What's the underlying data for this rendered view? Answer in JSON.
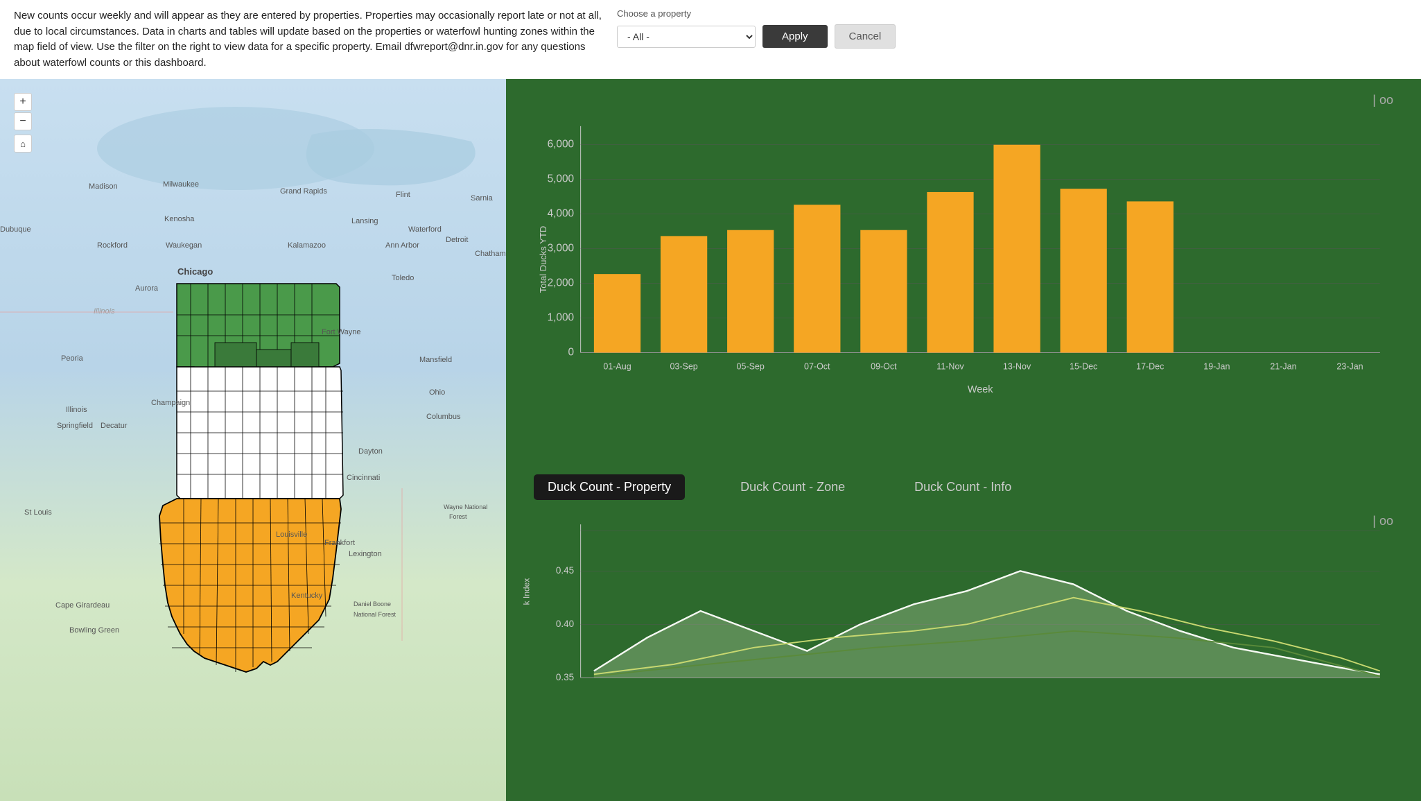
{
  "topbar": {
    "description": "New counts occur weekly and will appear as they are entered by properties. Properties may occasionally report late or not at all, due to local circumstances. Data in charts and tables will update based on the properties or waterfowl hunting zones within the map field of view.  Use the filter on the right to view data for a specific property.  Email dfwreport@dnr.in.gov for any questions about waterfowl counts or this dashboard.",
    "email_link": "dfwreport@dnr.in.gov",
    "choose_label": "Choose a property",
    "select_default": "- All -",
    "apply_label": "Apply",
    "cancel_label": "Cancel"
  },
  "map": {
    "zoom_in_label": "+",
    "zoom_out_label": "−",
    "home_icon": "⌂"
  },
  "chart": {
    "y_label": "Total Ducks YTD",
    "x_label": "Week",
    "icons": "oo",
    "bars": [
      {
        "week": "01-Aug",
        "value": 2500
      },
      {
        "week": "03-Sep",
        "value": 3700
      },
      {
        "week": "05-Sep",
        "value": 3900
      },
      {
        "week": "07-Oct",
        "value": 4700
      },
      {
        "week": "09-Oct",
        "value": 3900
      },
      {
        "week": "11-Nov",
        "value": 5100
      },
      {
        "week": "13-Nov",
        "value": 6600
      },
      {
        "week": "15-Dec",
        "value": 5200
      },
      {
        "week": "17-Dec",
        "value": 4800
      },
      {
        "week": "19-Jan",
        "value": 0
      },
      {
        "week": "21-Jan",
        "value": 0
      },
      {
        "week": "23-Jan",
        "value": 0
      }
    ],
    "y_ticks": [
      "0",
      "1,000",
      "2,000",
      "3,000",
      "4,000",
      "5,000",
      "6,000"
    ],
    "bar_color": "#f5a623"
  },
  "tabs": [
    {
      "label": "Duck Count - Property",
      "active": true
    },
    {
      "label": "Duck Count - Zone",
      "active": false
    },
    {
      "label": "Duck Count - Info",
      "active": false
    }
  ],
  "bottom_chart": {
    "y_label": "k Index",
    "icons": "oo",
    "y_ticks": [
      "0.35",
      "0.40",
      "0.45"
    ]
  },
  "wayne_national": "Wayne National Forest",
  "daniel_boone": "Daniel Boone\nNational Forest"
}
